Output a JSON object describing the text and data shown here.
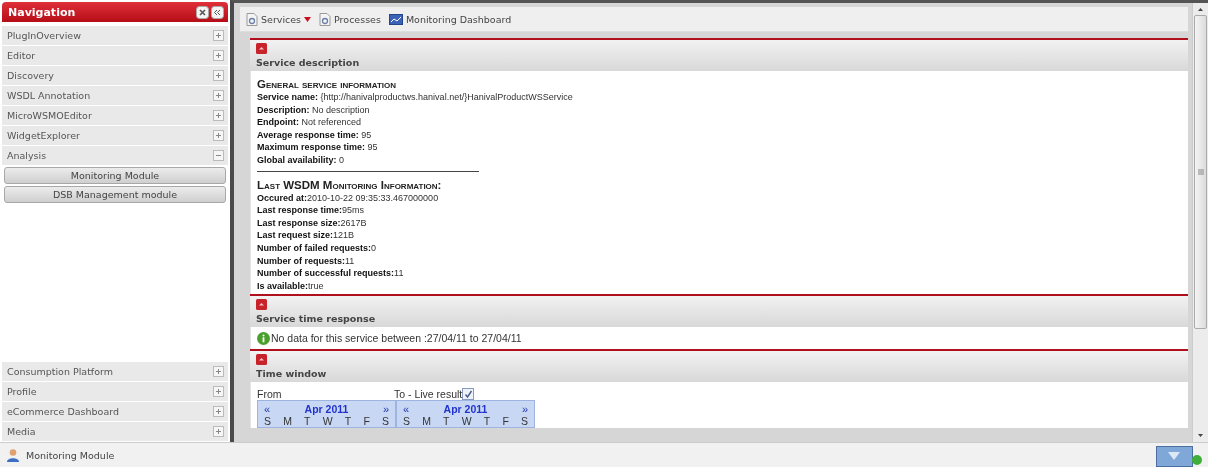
{
  "navigation": {
    "title": "Navigation",
    "items": [
      {
        "label": "PlugInOverview",
        "expanded": false
      },
      {
        "label": "Editor",
        "expanded": false
      },
      {
        "label": "Discovery",
        "expanded": false
      },
      {
        "label": "WSDL Annotation",
        "expanded": false
      },
      {
        "label": "MicroWSMOEditor",
        "expanded": false
      },
      {
        "label": "WidgetExplorer",
        "expanded": false
      },
      {
        "label": "Analysis",
        "expanded": true,
        "children": [
          "Monitoring Module",
          "DSB Management module"
        ]
      }
    ],
    "bottom_items": [
      {
        "label": "Consumption Platform",
        "expanded": false
      },
      {
        "label": "Profile",
        "expanded": false
      },
      {
        "label": "eCommerce Dashboard",
        "expanded": false
      },
      {
        "label": "Media",
        "expanded": false
      }
    ]
  },
  "toolbar": [
    {
      "label": "Services",
      "kind": "menu"
    },
    {
      "label": "Processes",
      "kind": "plain"
    },
    {
      "label": "Monitoring Dashboard",
      "kind": "dashboard"
    }
  ],
  "sections": [
    {
      "title": "Service description",
      "kind": "info",
      "blocks": [
        {
          "heading": "General service information",
          "lines": [
            "**Service name:** {http://hanivalproductws.hanival.net/}HanivalProductWSService",
            "**Description:** No description",
            "**Endpoint:** Not referenced",
            "**Average response time:** 95",
            "**Maximum response time:** 95",
            "**Global availability:** 0"
          ]
        },
        {
          "heading": "Last WSDM Monitoring Information:",
          "lines": [
            "**Occured at:**2010-10-22 09:35:33.467000000",
            "**Last response time:**95ms",
            "**Last response size:**2617B",
            "**Last request size:**121B",
            "**Number of failed requests:**0",
            "**Number of requests:**11",
            "**Number of successful requests:**11",
            "**Is available:**true"
          ]
        }
      ]
    },
    {
      "title": "Service time response",
      "kind": "message",
      "message": "No data for this service between :27/04/11 to 27/04/11"
    },
    {
      "title": "Time window",
      "kind": "time_window",
      "from_label": "From",
      "to_label": "To - Live result",
      "live": true,
      "calendars": [
        {
          "prev": "«",
          "month": "Apr 2011",
          "next": "»",
          "weekdays": [
            "S",
            "M",
            "T",
            "W",
            "T",
            "F",
            "S"
          ]
        },
        {
          "prev": "«",
          "month": "Apr 2011",
          "next": "»",
          "weekdays": [
            "S",
            "M",
            "T",
            "W",
            "T",
            "F",
            "S"
          ]
        }
      ]
    }
  ],
  "status_bar": {
    "label": "Monitoring Module"
  }
}
